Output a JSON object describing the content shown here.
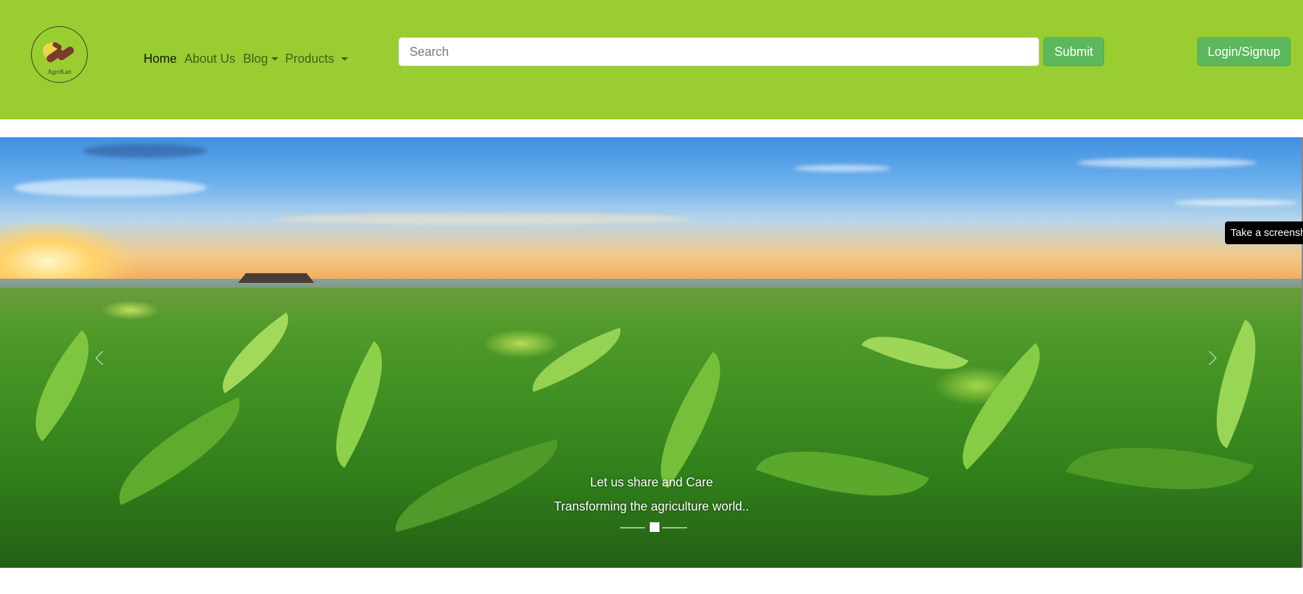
{
  "brand": {
    "logo_text": "AgroKart"
  },
  "nav": {
    "home": "Home",
    "about": "About Us",
    "blog": "Blog",
    "products": "Products"
  },
  "search": {
    "placeholder": "Search",
    "submit_label": "Submit"
  },
  "auth": {
    "login_label": "Login/Signup"
  },
  "carousel": {
    "caption_title": "Let us share and Care",
    "caption_subtitle": "Transforming the agriculture world..",
    "active_slide": 1,
    "slide_count": 3
  },
  "tooltip": {
    "text": "Take a screenshot"
  },
  "colors": {
    "header_bg": "#9acd32",
    "button_green": "#5cb85c"
  }
}
